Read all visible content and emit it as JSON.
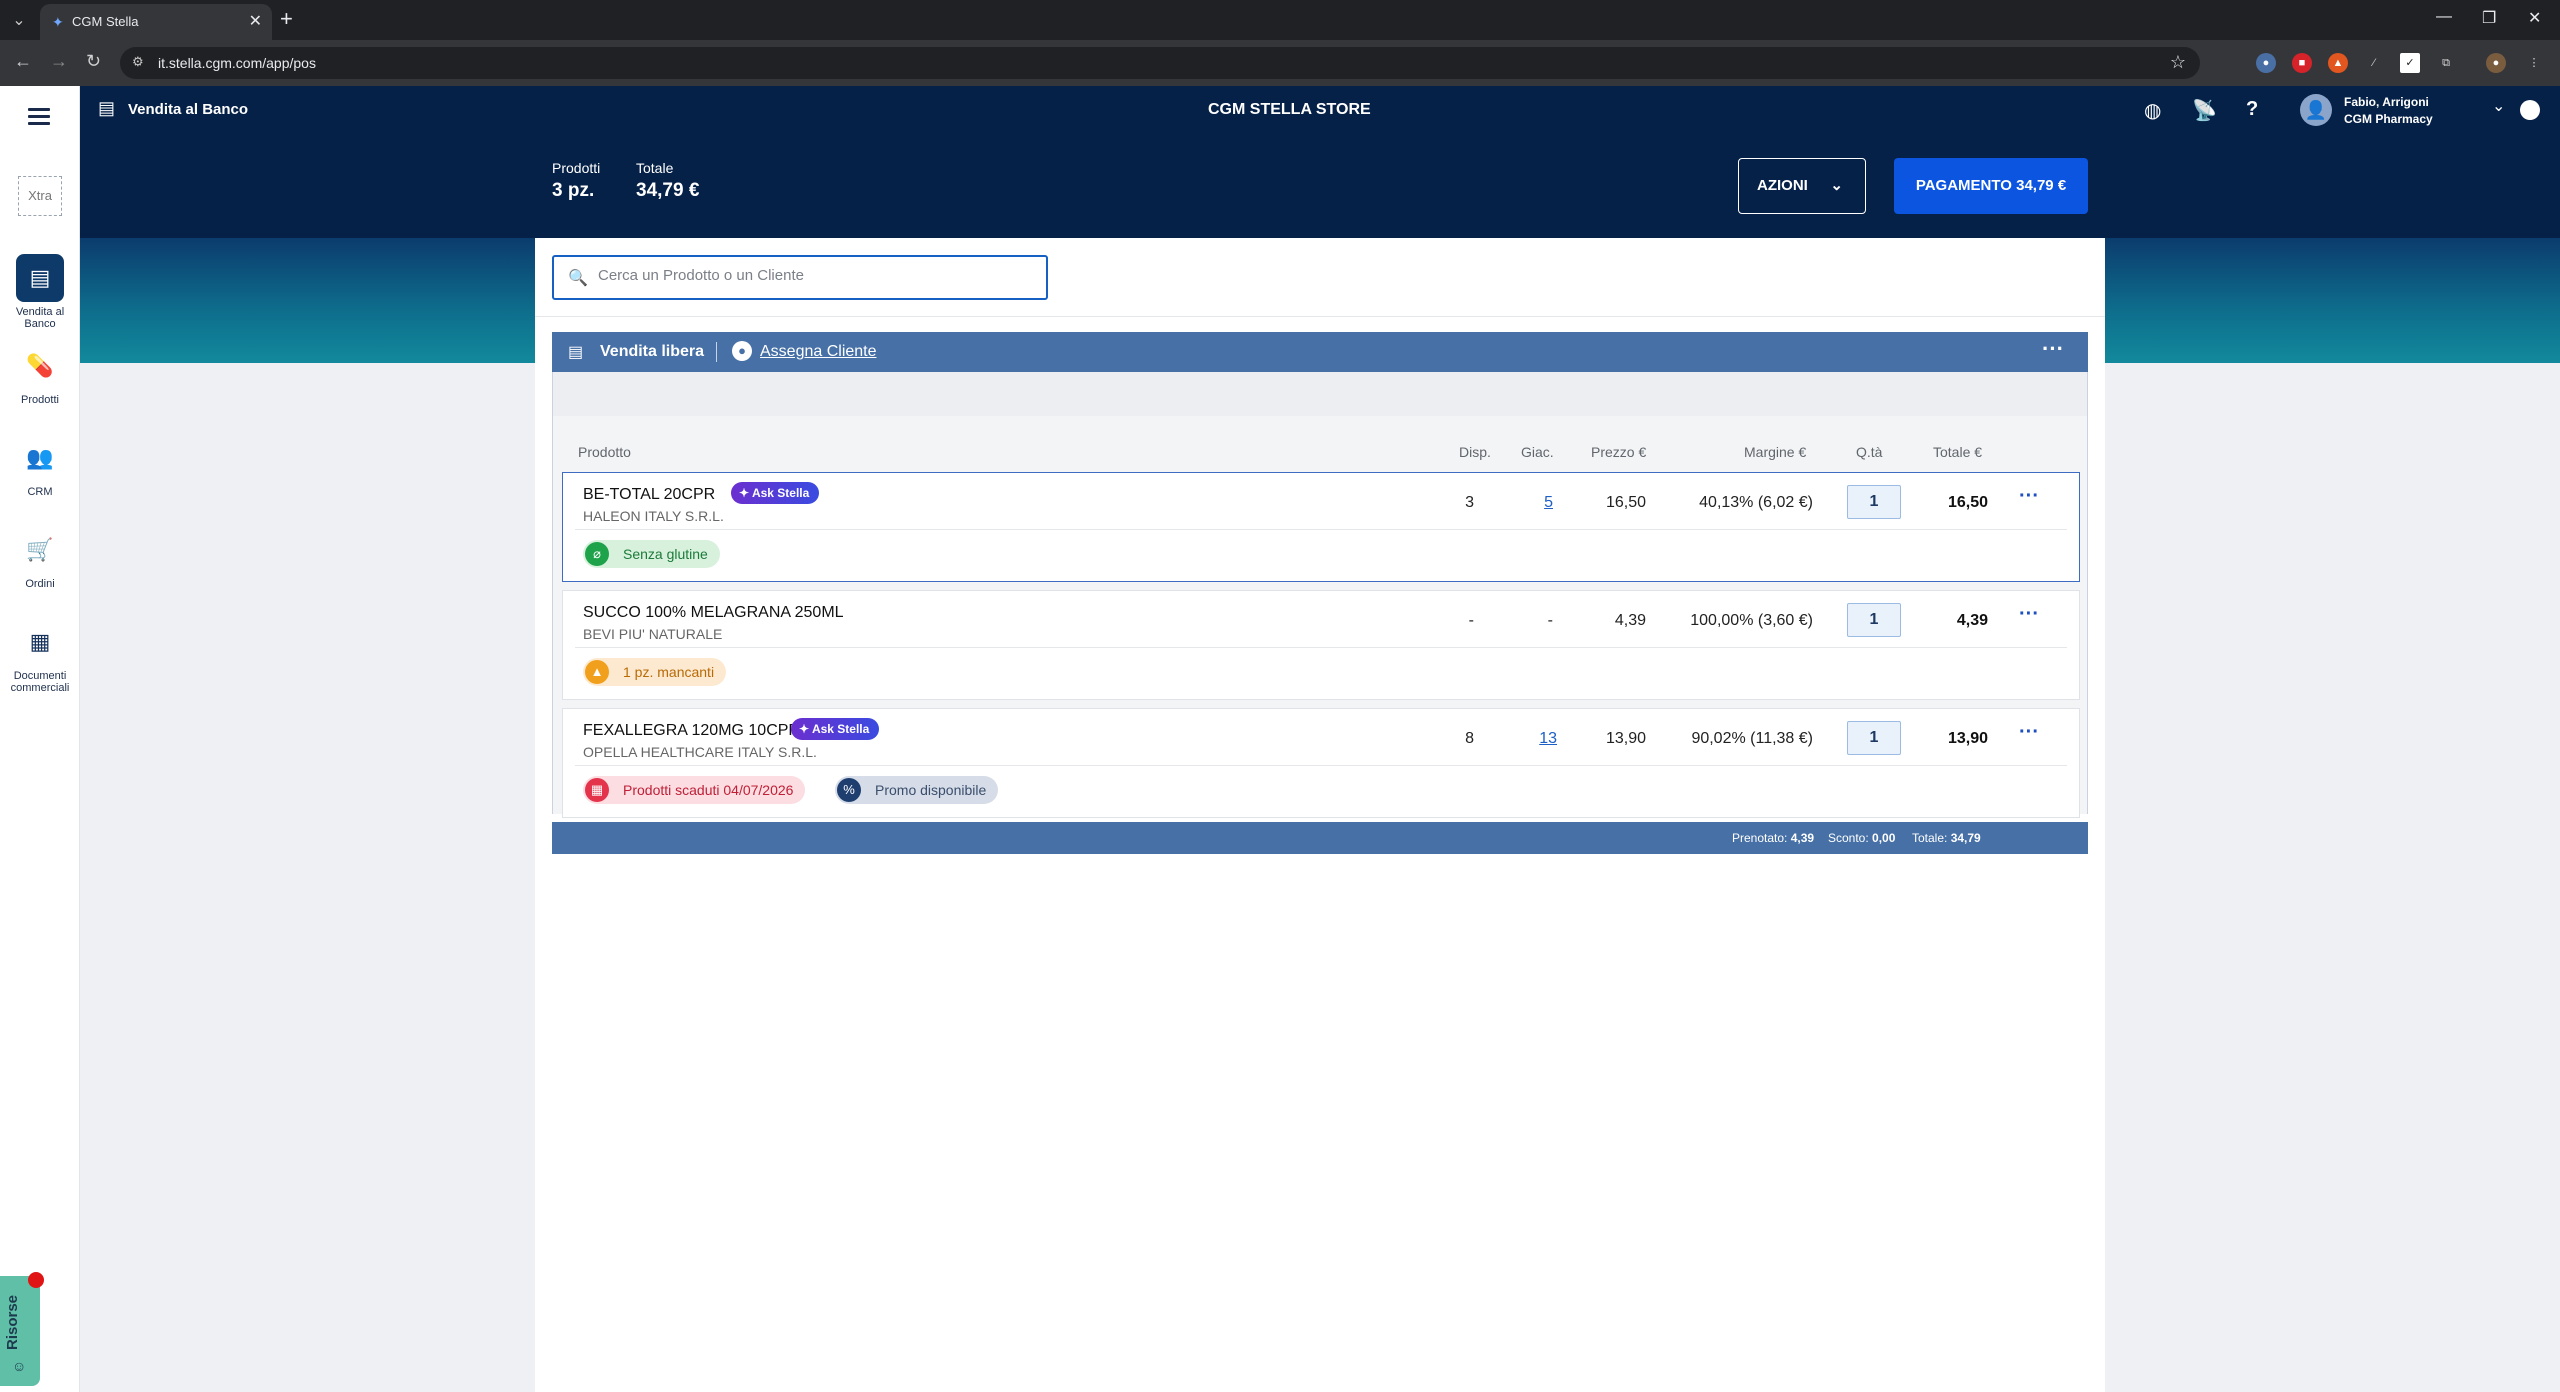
{
  "browser": {
    "tab_title": "CGM Stella",
    "url": "it.stella.cgm.com/app/pos"
  },
  "app": {
    "module_title": "Vendita al Banco",
    "store_name": "CGM STELLA STORE",
    "user": {
      "name": "Fabio, Arrigoni",
      "org": "CGM Pharmacy"
    }
  },
  "sidebar": {
    "xtra_label": "Xtra",
    "items": [
      {
        "label": "Vendita al Banco",
        "icon": "register-icon"
      },
      {
        "label": "Prodotti",
        "icon": "pill-icon"
      },
      {
        "label": "CRM",
        "icon": "people-icon"
      },
      {
        "label": "Ordini",
        "icon": "cart-icon"
      },
      {
        "label": "Documenti commerciali",
        "icon": "document-icon"
      }
    ],
    "risorse_label": "Risorse"
  },
  "summary": {
    "products_label": "Prodotti",
    "products_value": "3 pz.",
    "total_label": "Totale",
    "total_value": "34,79 €",
    "actions_label": "AZIONI",
    "pay_label": "PAGAMENTO 34,79 €"
  },
  "search": {
    "placeholder": "Cerca un Prodotto o un Cliente"
  },
  "sale": {
    "title": "Vendita libera",
    "assign_customer": "Assegna Cliente"
  },
  "columns": {
    "product": "Prodotto",
    "available": "Disp.",
    "stock": "Giac.",
    "price": "Prezzo €",
    "margin": "Margine €",
    "qty": "Q.tà",
    "total": "Totale €"
  },
  "rows": [
    {
      "name": "BE-TOTAL 20CPR",
      "manufacturer": "HALEON ITALY S.R.L.",
      "ask_stella": "Ask Stella",
      "available": "3",
      "stock": "5",
      "price": "16,50",
      "margin": "40,13% (6,02 €)",
      "qty": "1",
      "total": "16,50",
      "tags": [
        {
          "label": "Senza glutine",
          "icon": "no-gluten-icon",
          "color": "#1ea24a"
        }
      ]
    },
    {
      "name": "SUCCO 100% MELAGRANA 250ML",
      "manufacturer": "BEVI PIU' NATURALE",
      "available": "-",
      "stock": "-",
      "price": "4,39",
      "margin": "100,00% (3,60 €)",
      "qty": "1",
      "total": "4,39",
      "tags": [
        {
          "label": "1 pz. mancanti",
          "icon": "warning-icon",
          "color": "#f0a01c"
        }
      ]
    },
    {
      "name": "FEXALLEGRA 120MG 10CPR",
      "manufacturer": "OPELLA HEALTHCARE ITALY S.R.L.",
      "ask_stella": "Ask Stella",
      "available": "8",
      "stock": "13",
      "price": "13,90",
      "margin": "90,02% (11,38 €)",
      "qty": "1",
      "total": "13,90",
      "tags": [
        {
          "label": "Prodotti scaduti 04/07/2026",
          "icon": "calendar-icon",
          "color": "#e3344b"
        },
        {
          "label": "Promo disponibile",
          "icon": "promo-icon",
          "color": "#1d3e6e"
        }
      ]
    }
  ],
  "footer": {
    "reserved_label": "Prenotato:",
    "reserved_value": "4,39",
    "discount_label": "Sconto:",
    "discount_value": "0,00",
    "total_label": "Totale:",
    "total_value": "34,79"
  }
}
